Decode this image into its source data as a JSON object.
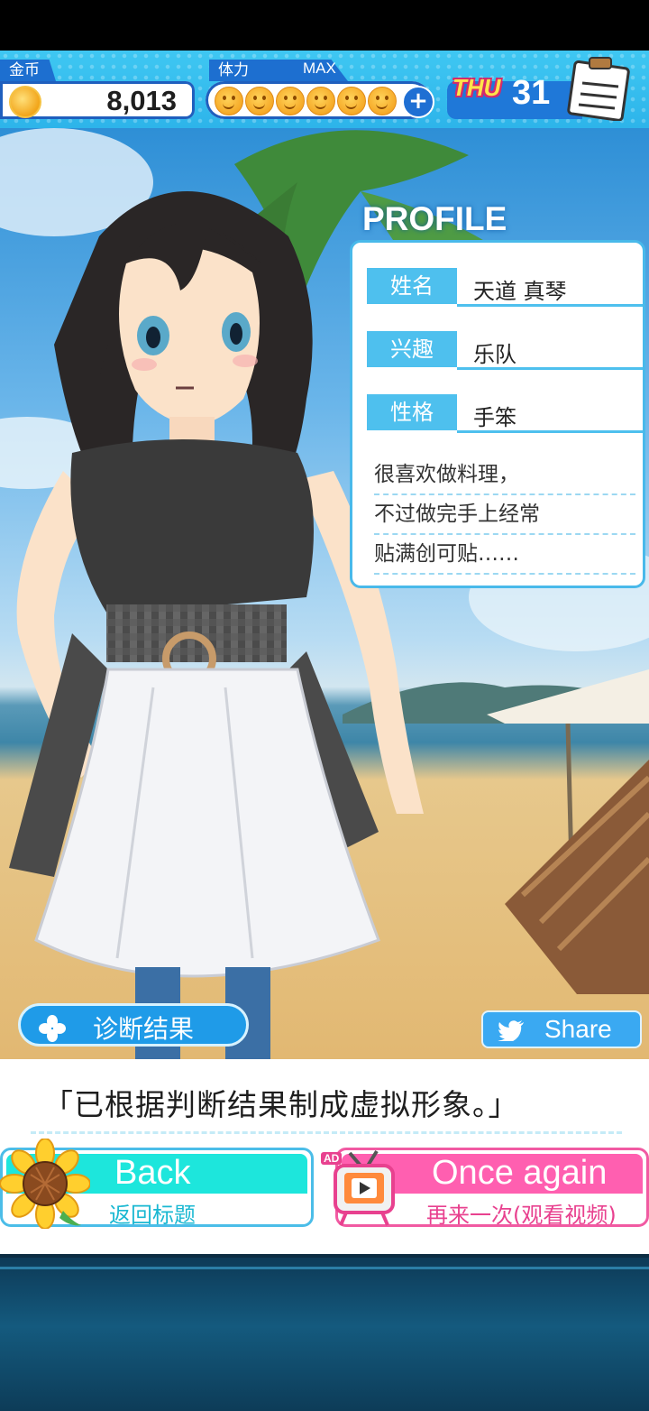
{
  "hud": {
    "gold_label": "金币",
    "gold_value": "8,013",
    "stamina_label": "体力",
    "stamina_max_label": "MAX",
    "stamina_icons": 6,
    "stamina_plus": "+",
    "day_name": "THU",
    "day_number": "31"
  },
  "profile": {
    "title": "PROFILE",
    "fields": [
      {
        "key": "姓名",
        "value": "天道 真琴"
      },
      {
        "key": "兴趣",
        "value": "乐队"
      },
      {
        "key": "性格",
        "value": "手笨"
      }
    ],
    "description": [
      "很喜欢做料理，",
      "不过做完手上经常",
      "贴满创可贴……"
    ]
  },
  "scene": {
    "diagnosis_label": "诊断结果",
    "share_label": "Share"
  },
  "dialog": {
    "text": "「已根据判断结果制成虚拟形象。」"
  },
  "buttons": {
    "back_en": "Back",
    "back_zh": "返回标题",
    "again_badge": "AD",
    "again_en": "Once again",
    "again_zh": "再来一次(观看视频)"
  },
  "colors": {
    "hud_blue": "#2db4ea",
    "card_accent": "#4ec0ee",
    "back_fill": "#1de6dc",
    "again_fill": "#ff5fb0"
  }
}
